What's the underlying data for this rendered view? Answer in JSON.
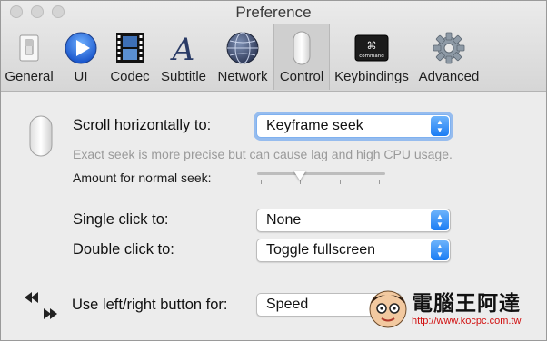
{
  "window": {
    "title": "Preference"
  },
  "toolbar": {
    "tabs": [
      {
        "label": "General",
        "icon": "switch-icon"
      },
      {
        "label": "UI",
        "icon": "play-icon"
      },
      {
        "label": "Codec",
        "icon": "film-icon"
      },
      {
        "label": "Subtitle",
        "icon": "letter-a-icon"
      },
      {
        "label": "Network",
        "icon": "globe-icon"
      },
      {
        "label": "Control",
        "icon": "mouse-icon",
        "selected": true
      },
      {
        "label": "Keybindings",
        "icon": "command-key-icon",
        "key_glyph": "⌘",
        "key_caption": "command"
      },
      {
        "label": "Advanced",
        "icon": "gear-icon"
      }
    ]
  },
  "control": {
    "scroll_label": "Scroll horizontally to:",
    "scroll_value": "Keyframe seek",
    "scroll_hint": "Exact seek is more precise but can cause lag and high CPU usage.",
    "seek_amount_label": "Amount for normal seek:",
    "seek_amount_level": 0.33,
    "single_click_label": "Single click to:",
    "single_click_value": "None",
    "double_click_label": "Double click to:",
    "double_click_value": "Toggle fullscreen",
    "lr_button_label": "Use left/right button for:",
    "lr_button_value": "Speed"
  },
  "watermark": {
    "text": "電腦王阿達",
    "url": "http://www.kocpc.com.tw"
  },
  "colors": {
    "accent": "#1a7cf4",
    "selected_tab": "#cfcfcf"
  }
}
